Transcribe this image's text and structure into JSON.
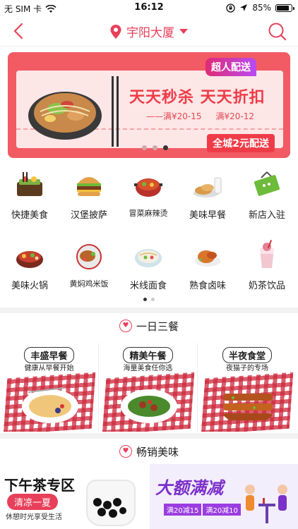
{
  "status_bar": {
    "carrier": "无 SIM 卡",
    "time": "16:12",
    "battery": "85%",
    "battery_level": 0.85
  },
  "nav": {
    "location": "宇阳大厦"
  },
  "banner": {
    "badge_top": "超人配送",
    "headline": "天天秒杀 天天折扣",
    "deal1": "——满¥20-15",
    "deal2": "满¥20-12",
    "badge_bottom": "全城2元配送",
    "slide_count": 3,
    "active_slide": 3
  },
  "categories": [
    {
      "label": "快捷美食",
      "icon": "bento-box-icon"
    },
    {
      "label": "汉堡披萨",
      "icon": "burger-icon"
    },
    {
      "label": "冒菜麻辣烫",
      "icon": "spicy-pot-icon"
    },
    {
      "label": "美味早餐",
      "icon": "breakfast-icon"
    },
    {
      "label": "新店入驻",
      "icon": "new-store-sign-icon"
    },
    {
      "label": "美味火锅",
      "icon": "hotpot-icon"
    },
    {
      "label": "黄焖鸡米饭",
      "icon": "braised-chicken-icon"
    },
    {
      "label": "米线面食",
      "icon": "noodle-bowl-icon"
    },
    {
      "label": "熟食卤味",
      "icon": "braised-meat-icon"
    },
    {
      "label": "奶茶饮品",
      "icon": "milk-tea-icon"
    }
  ],
  "section_meals": {
    "title": "一日三餐"
  },
  "meals": [
    {
      "title": "丰盛早餐",
      "desc": "健康从早餐开始"
    },
    {
      "title": "精美午餐",
      "desc": "海量美食任你选"
    },
    {
      "title": "半夜食堂",
      "desc": "夜猫子的专场"
    }
  ],
  "section_hot": {
    "title": "畅销美味"
  },
  "promos": {
    "left": {
      "title": "下午茶专区",
      "pill": "清凉一夏",
      "sub": "休憩时光享受生活"
    },
    "right": {
      "title": "大额满减",
      "tag1": "满20减15",
      "tag2": "满20减10"
    }
  }
}
